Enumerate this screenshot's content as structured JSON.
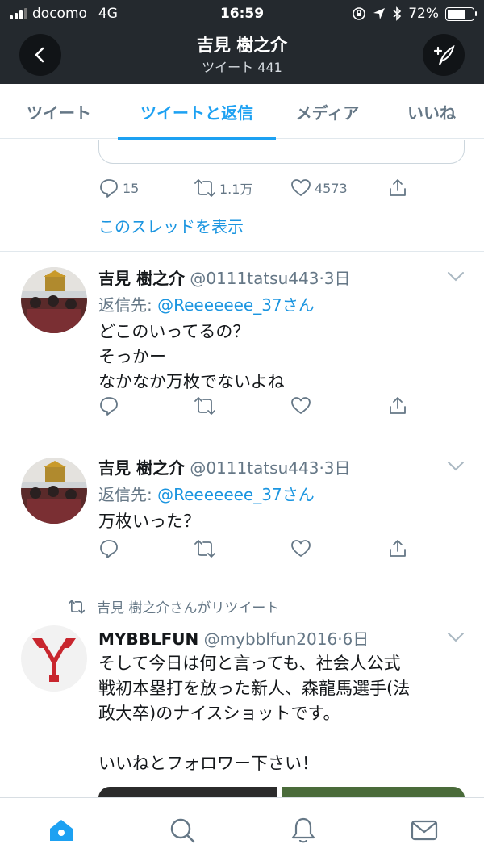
{
  "status_bar": {
    "carrier": "docomo",
    "network": "4G",
    "time": "16:59",
    "battery": "72%",
    "battery_level": 0.72
  },
  "header": {
    "title": "吉見 樹之介",
    "subtitle": "ツイート 441"
  },
  "tabs": [
    {
      "label": "ツイート",
      "active": false
    },
    {
      "label": "ツイートと返信",
      "active": true
    },
    {
      "label": "メディア",
      "active": false
    },
    {
      "label": "いいね",
      "active": false
    }
  ],
  "top_tweet": {
    "replies": "15",
    "retweets": "1.1万",
    "likes": "4573",
    "thread_link": "このスレッドを表示"
  },
  "tweets": [
    {
      "name": "吉見 樹之介",
      "handle": "@0111tatsu443",
      "dot": "·",
      "time": "3日",
      "reply_prefix": "返信先: ",
      "reply_to": "@Reeeeeee_37さん",
      "text": "どこのいってるの？\nそっかー\nなかなか万枚でないよね"
    },
    {
      "name": "吉見 樹之介",
      "handle": "@0111tatsu443",
      "dot": "·",
      "time": "3日",
      "reply_prefix": "返信先: ",
      "reply_to": "@Reeeeeee_37さん",
      "text": "万枚いった？"
    },
    {
      "retweeted_by": "吉見 樹之介さんがリツイート",
      "name": "MYBBLFUN",
      "handle": "@mybblfun2016",
      "dot": "·",
      "time": "6日",
      "text": "そして今日は何と言っても、社会人公式\n戦初本塁打を放った新人、森龍馬選手(法\n政大卒)のナイスショットです。\n\nいいねとフォロワー下さい！"
    }
  ],
  "colors": {
    "accent": "#1da1f2",
    "link": "#1b95e0",
    "muted": "#657786",
    "header_bg": "#24292e"
  },
  "icons": [
    "back-icon",
    "compose-icon",
    "reply-icon",
    "retweet-icon",
    "like-icon",
    "share-icon",
    "chevron-down-icon",
    "home-icon",
    "search-icon",
    "notifications-icon",
    "messages-icon"
  ]
}
